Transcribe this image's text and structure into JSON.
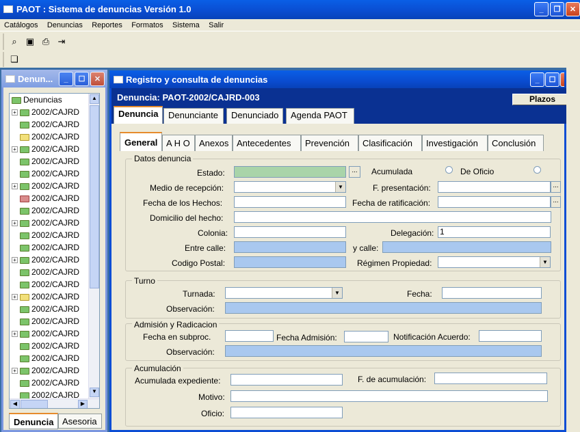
{
  "app": {
    "title": "PAOT : Sistema de denuncias Versión 1.0"
  },
  "menu": [
    "Catálogos",
    "Denuncias",
    "Reportes",
    "Formatos",
    "Sistema",
    "Salir"
  ],
  "left_window": {
    "title": "Denun...",
    "root": "Denuncias",
    "items": [
      {
        "label": "2002/CAJRD",
        "color": "green",
        "expand": true
      },
      {
        "label": "2002/CAJRD",
        "color": "green",
        "expand": false
      },
      {
        "label": "2002/CAJRD",
        "color": "yellow",
        "expand": false
      },
      {
        "label": "2002/CAJRD",
        "color": "green",
        "expand": true
      },
      {
        "label": "2002/CAJRD",
        "color": "green",
        "expand": false
      },
      {
        "label": "2002/CAJRD",
        "color": "green",
        "expand": false
      },
      {
        "label": "2002/CAJRD",
        "color": "green",
        "expand": true
      },
      {
        "label": "2002/CAJRD",
        "color": "red",
        "expand": false
      },
      {
        "label": "2002/CAJRD",
        "color": "green",
        "expand": false
      },
      {
        "label": "2002/CAJRD",
        "color": "green",
        "expand": true
      },
      {
        "label": "2002/CAJRD",
        "color": "green",
        "expand": false
      },
      {
        "label": "2002/CAJRD",
        "color": "green",
        "expand": false
      },
      {
        "label": "2002/CAJRD",
        "color": "green",
        "expand": true
      },
      {
        "label": "2002/CAJRD",
        "color": "green",
        "expand": false
      },
      {
        "label": "2002/CAJRD",
        "color": "green",
        "expand": false
      },
      {
        "label": "2002/CAJRD",
        "color": "yellow",
        "expand": true
      },
      {
        "label": "2002/CAJRD",
        "color": "green",
        "expand": false
      },
      {
        "label": "2002/CAJRD",
        "color": "green",
        "expand": false
      },
      {
        "label": "2002/CAJRD",
        "color": "green",
        "expand": true
      },
      {
        "label": "2002/CAJRD",
        "color": "green",
        "expand": false
      },
      {
        "label": "2002/CAJRD",
        "color": "green",
        "expand": false
      },
      {
        "label": "2002/CAJRD",
        "color": "green",
        "expand": true
      },
      {
        "label": "2002/CAJRD",
        "color": "green",
        "expand": false
      },
      {
        "label": "2002/CAJRD",
        "color": "green",
        "expand": false
      }
    ],
    "tabs": [
      "Denuncia",
      "Asesoria"
    ]
  },
  "main_window": {
    "title": "Registro y consulta de denuncias",
    "header": "Denuncia: PAOT-2002/CAJRD-003",
    "plazos": "Plazos",
    "tabs": [
      "Denuncia",
      "Denunciante",
      "Denunciado",
      "Agenda PAOT"
    ],
    "subtabs": [
      "General",
      "A H O",
      "Anexos",
      "Antecedentes",
      "Prevención",
      "Clasificación",
      "Investigación",
      "Conclusión"
    ],
    "datos": {
      "title": "Datos denuncia",
      "estado": "Estado:",
      "acumulada": "Acumulada",
      "de_oficio": "De Oficio",
      "medio": "Medio de recepción:",
      "f_presentacion": "F. presentación:",
      "fecha_hechos": "Fecha de los Hechos:",
      "fecha_ratificacion": "Fecha de ratificación:",
      "domicilio": "Domicilio del hecho:",
      "colonia": "Colonia:",
      "delegacion": "Delegación:",
      "delegacion_value": "1",
      "entre_calle": "Entre calle:",
      "y_calle": "y calle:",
      "cp": "Codigo Postal:",
      "regimen": "Régimen Propiedad:"
    },
    "turno": {
      "title": "Turno",
      "turnada": "Turnada:",
      "fecha": "Fecha:",
      "observacion": "Observación:"
    },
    "admision": {
      "title": "Admisión y Radicacion",
      "fecha_subproc": "Fecha en subproc.",
      "fecha_admision": "Fecha Admisión:",
      "notificacion": "Notificación Acuerdo:",
      "observacion": "Observación:"
    },
    "acumulacion": {
      "title": "Acumulación",
      "expediente": "Acumulada expediente:",
      "f_acumulacion": "F. de acumulación:",
      "motivo": "Motivo:",
      "oficio": "Oficio:"
    }
  }
}
